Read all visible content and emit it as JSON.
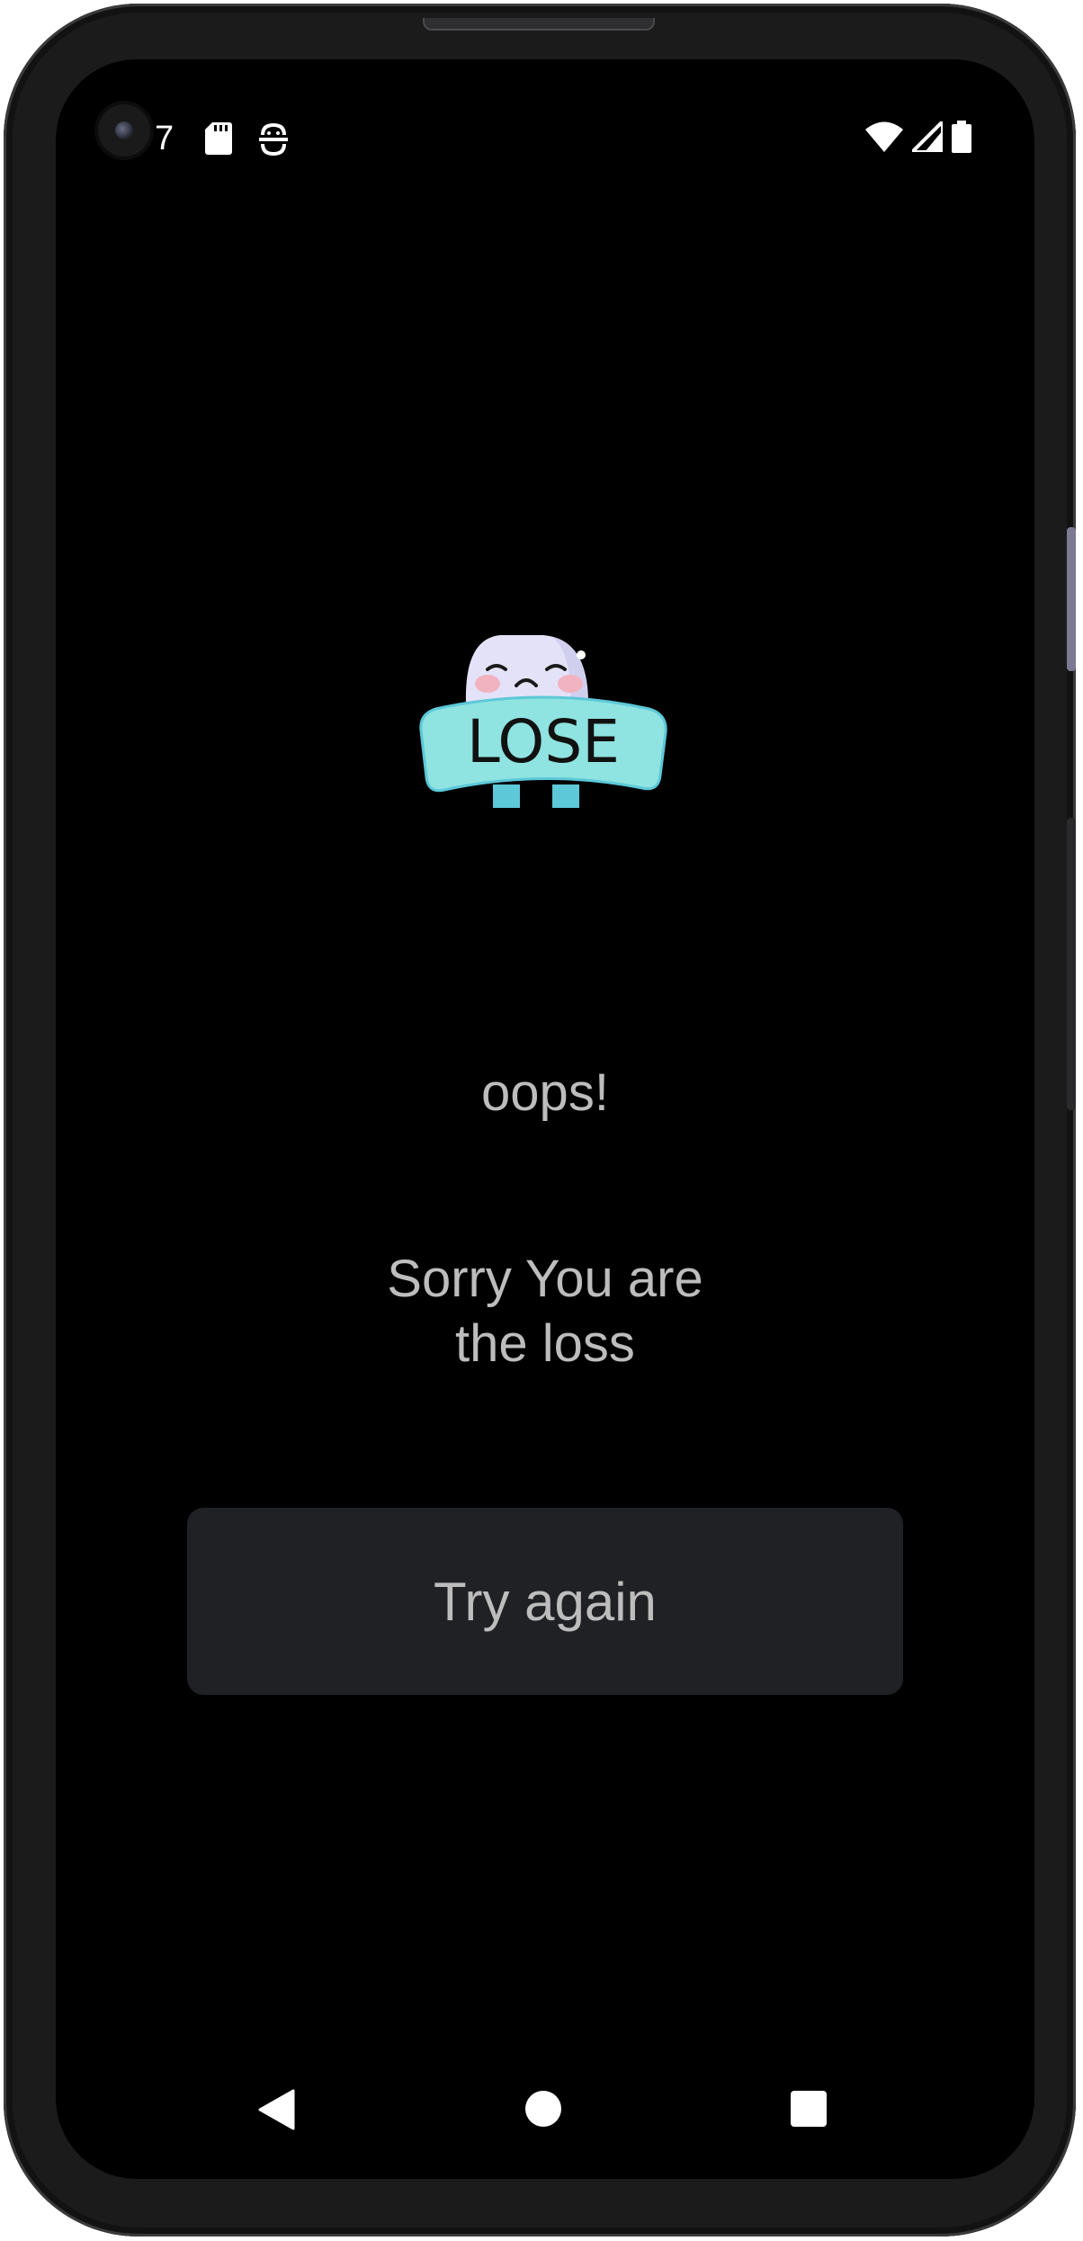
{
  "status_bar": {
    "time": "7",
    "left_icons": [
      "sd-card-icon",
      "face-recognition-icon"
    ],
    "right_icons": [
      "wifi-icon",
      "cell-signal-icon",
      "battery-icon"
    ]
  },
  "illustration": {
    "icon": "lose-mascot-icon",
    "sign_text": "LOSE"
  },
  "result": {
    "title": "oops!",
    "message_line1": "Sorry You are",
    "message_line2": "the loss"
  },
  "actions": {
    "try_again_label": "Try again"
  },
  "nav_bar": {
    "icons": [
      "back-icon",
      "home-icon",
      "recents-icon"
    ]
  },
  "colors": {
    "background": "#000000",
    "text": "#bdbdbd",
    "button_bg": "#202124",
    "mascot_sign": "#8fe3e0",
    "mascot_head": "#e4e2f8",
    "mascot_cheek": "#f2b3c0"
  }
}
